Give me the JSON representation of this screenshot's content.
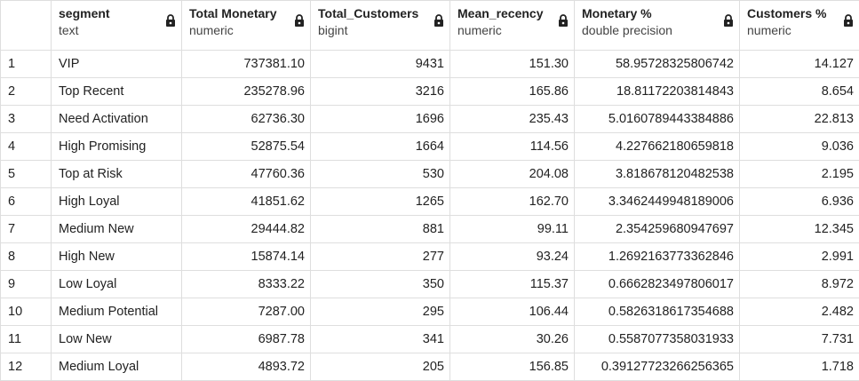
{
  "columns": [
    {
      "name": "segment",
      "type": "text"
    },
    {
      "name": "Total Monetary",
      "type": "numeric"
    },
    {
      "name": "Total_Customers",
      "type": "bigint"
    },
    {
      "name": "Mean_recency",
      "type": "numeric"
    },
    {
      "name": "Monetary %",
      "type": "double precision"
    },
    {
      "name": "Customers %",
      "type": "numeric"
    }
  ],
  "rows": [
    {
      "n": "1",
      "cells": [
        "VIP",
        "737381.10",
        "9431",
        "151.30",
        "58.95728325806742",
        "14.127"
      ]
    },
    {
      "n": "2",
      "cells": [
        "Top Recent",
        "235278.96",
        "3216",
        "165.86",
        "18.81172203814843",
        "8.654"
      ]
    },
    {
      "n": "3",
      "cells": [
        "Need Activation",
        "62736.30",
        "1696",
        "235.43",
        "5.0160789443384886",
        "22.813"
      ]
    },
    {
      "n": "4",
      "cells": [
        "High Promising",
        "52875.54",
        "1664",
        "114.56",
        "4.227662180659818",
        "9.036"
      ]
    },
    {
      "n": "5",
      "cells": [
        "Top at Risk",
        "47760.36",
        "530",
        "204.08",
        "3.818678120482538",
        "2.195"
      ]
    },
    {
      "n": "6",
      "cells": [
        "High Loyal",
        "41851.62",
        "1265",
        "162.70",
        "3.3462449948189006",
        "6.936"
      ]
    },
    {
      "n": "7",
      "cells": [
        "Medium New",
        "29444.82",
        "881",
        "99.11",
        "2.354259680947697",
        "12.345"
      ]
    },
    {
      "n": "8",
      "cells": [
        "High New",
        "15874.14",
        "277",
        "93.24",
        "1.2692163773362846",
        "2.991"
      ]
    },
    {
      "n": "9",
      "cells": [
        "Low Loyal",
        "8333.22",
        "350",
        "115.37",
        "0.6662823497806017",
        "8.972"
      ]
    },
    {
      "n": "10",
      "cells": [
        "Medium Potential",
        "7287.00",
        "295",
        "106.44",
        "0.5826318617354688",
        "2.482"
      ]
    },
    {
      "n": "11",
      "cells": [
        "Low New",
        "6987.78",
        "341",
        "30.26",
        "0.5587077358031933",
        "7.731"
      ]
    },
    {
      "n": "12",
      "cells": [
        "Medium Loyal",
        "4893.72",
        "205",
        "156.85",
        "0.39127723266256365",
        "1.718"
      ]
    }
  ],
  "icons": {
    "column_lock": "lock-icon"
  },
  "colors": {
    "border": "#dedede",
    "header_bg": "#ffffff",
    "text": "#222222"
  }
}
